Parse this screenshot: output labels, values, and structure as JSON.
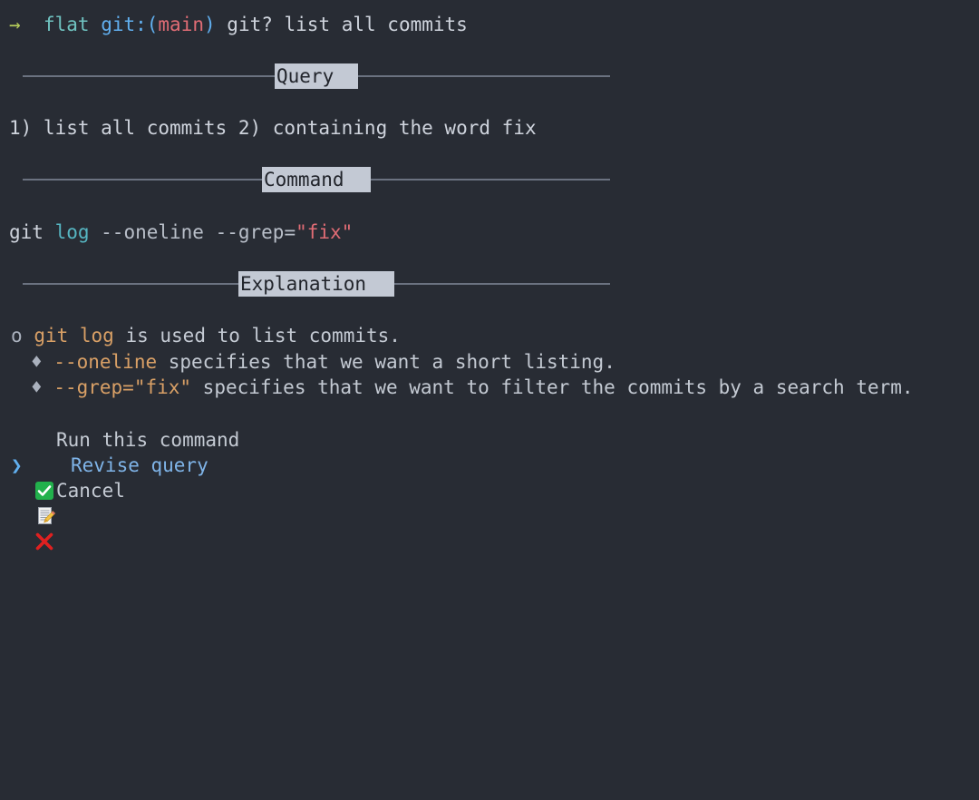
{
  "terminal": {
    "background_color": "#282c34",
    "foreground_color": "#c8ccd4"
  },
  "prompt": {
    "arrow": "→",
    "directory": "flat",
    "git_prefix": "git:(",
    "branch": "main",
    "git_suffix": ")",
    "command": "git? list all commits",
    "colors": {
      "arrow": "#b5cc5a",
      "directory": "#6fc2c0",
      "git": "#61afef",
      "branch": "#e06c75",
      "command": "#cfd4dd"
    }
  },
  "sections": {
    "query": {
      "label": "Query",
      "text": "1) list all commits 2) containing the word fix"
    },
    "command": {
      "label": "Command",
      "tokens": [
        {
          "text": "git ",
          "kind": "plain"
        },
        {
          "text": "log",
          "kind": "keyword"
        },
        {
          "text": " --oneline --grep=",
          "kind": "flag"
        },
        {
          "text": "\"fix\"",
          "kind": "string"
        }
      ],
      "full_text": "git log --oneline --grep=\"fix\""
    },
    "explanation": {
      "label": "Explanation",
      "items": [
        {
          "marker": "o",
          "level": 1,
          "code": "git log",
          "text": " is used to list commits."
        },
        {
          "marker": "♦",
          "level": 2,
          "code": "--oneline",
          "text": " specifies that we want a short listing."
        },
        {
          "marker": "♦",
          "level": 2,
          "code": "--grep=\"fix\"",
          "text": " specifies that we want to filter the commits by a search term."
        }
      ]
    }
  },
  "menu": {
    "cursor": "❯",
    "selected_index": 1,
    "options": [
      {
        "icon": "check-mark-button-icon",
        "label": "Run this command",
        "selected": false
      },
      {
        "icon": "memo-icon",
        "label": "Revise query",
        "selected": true
      },
      {
        "icon": "cross-mark-icon",
        "label": "Cancel",
        "selected": false
      }
    ]
  }
}
